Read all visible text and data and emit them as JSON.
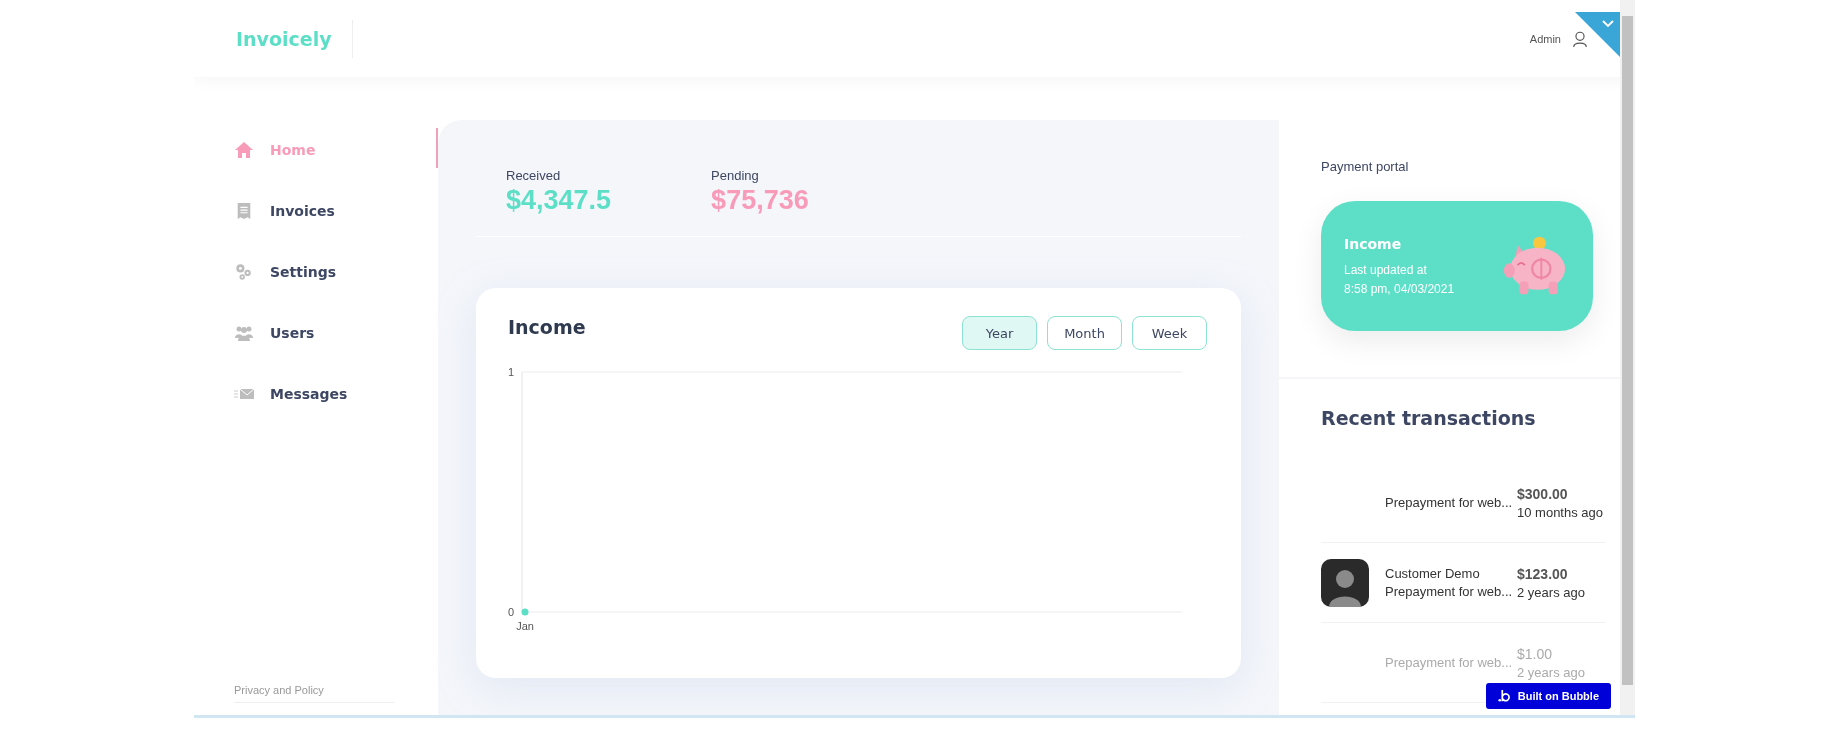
{
  "header": {
    "logo": "Invoicely",
    "user": "Admin"
  },
  "sidebar": {
    "items": [
      {
        "label": "Home",
        "selected": true
      },
      {
        "label": "Invoices",
        "selected": false
      },
      {
        "label": "Settings",
        "selected": false
      },
      {
        "label": "Users",
        "selected": false
      },
      {
        "label": "Messages",
        "selected": false
      }
    ],
    "footer_link": "Privacy and Policy"
  },
  "stats": [
    {
      "label": "Received",
      "value": "$4,347.5",
      "color": "#5ddfc7"
    },
    {
      "label": "Pending",
      "value": "$75,736",
      "color": "#f89bb8"
    }
  ],
  "income_chart": {
    "title": "Income",
    "periods": [
      {
        "label": "Year",
        "selected": true
      },
      {
        "label": "Month",
        "selected": false
      },
      {
        "label": "Week",
        "selected": false
      }
    ],
    "chart_data": {
      "type": "line",
      "categories": [
        "Jan"
      ],
      "ylim": [
        0,
        1
      ],
      "yticks": [
        0,
        1
      ],
      "series": [
        {
          "color": "#5ddfc7",
          "marker": true,
          "values": [
            0
          ]
        }
      ]
    }
  },
  "payment_portal": {
    "title": "Payment portal",
    "card_title": "Income",
    "card_text_1": "Last updated at",
    "card_text_2": "8:58 pm, 04/03/2021"
  },
  "recent_transactions": {
    "title": "Recent transactions",
    "rows": [
      {
        "avatar": false,
        "description": "Prepayment for web...",
        "amount": "$300.00",
        "time": "10 months ago",
        "dimmed": false
      },
      {
        "avatar": true,
        "name": "Customer Demo",
        "description": "Prepayment for web...",
        "amount": "$123.00",
        "time": "2 years ago",
        "dimmed": false
      },
      {
        "avatar": false,
        "description": "Prepayment for web...",
        "amount": "$1.00",
        "time": "2 years ago",
        "dimmed": true
      }
    ]
  },
  "badge": "Built on Bubble"
}
